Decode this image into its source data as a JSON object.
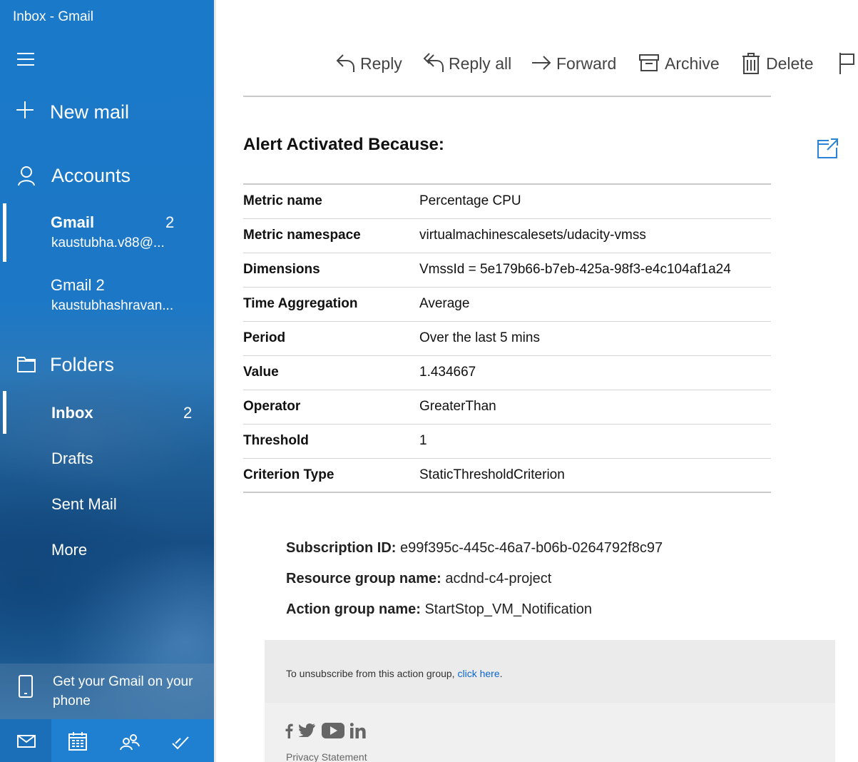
{
  "window": {
    "title": "Inbox - Gmail"
  },
  "sidebar": {
    "new_mail_label": "New mail",
    "accounts_label": "Accounts",
    "accounts": [
      {
        "name": "Gmail",
        "email": "kaustubha.v88@...",
        "unread": "2"
      },
      {
        "name": "Gmail 2",
        "email": "kaustubhashravan..."
      }
    ],
    "folders_label": "Folders",
    "folders": [
      {
        "label": "Inbox",
        "unread": "2"
      },
      {
        "label": "Drafts"
      },
      {
        "label": "Sent Mail"
      },
      {
        "label": "More"
      }
    ],
    "phone_promo": "Get your Gmail on your phone",
    "bottom_nav": [
      "mail-icon",
      "calendar-icon",
      "people-icon",
      "todo-icon"
    ]
  },
  "toolbar": {
    "reply": "Reply",
    "reply_all": "Reply all",
    "forward": "Forward",
    "archive": "Archive",
    "delete": "Delete"
  },
  "email": {
    "heading": "Alert Activated Because:",
    "metrics": [
      {
        "key": "Metric name",
        "value": "Percentage CPU"
      },
      {
        "key": "Metric namespace",
        "value": "virtualmachinescalesets/udacity-vmss"
      },
      {
        "key": "Dimensions",
        "value": "VmssId = 5e179b66-b7eb-425a-98f3-e4c104af1a24"
      },
      {
        "key": "Time Aggregation",
        "value": "Average"
      },
      {
        "key": "Period",
        "value": "Over the last 5 mins"
      },
      {
        "key": "Value",
        "value": "1.434667"
      },
      {
        "key": "Operator",
        "value": "GreaterThan"
      },
      {
        "key": "Threshold",
        "value": "1"
      },
      {
        "key": "Criterion Type",
        "value": "StaticThresholdCriterion"
      }
    ],
    "subscription_label": "Subscription ID:",
    "subscription_value": "e99f395c-445c-46a7-b06b-0264792f8c97",
    "resource_group_label": "Resource group name:",
    "resource_group_value": "acdnd-c4-project",
    "action_group_label": "Action group name:",
    "action_group_value": "StartStop_VM_Notification",
    "unsubscribe_text": "To unsubscribe from this action group, ",
    "unsubscribe_link": "click here",
    "unsubscribe_end": ".",
    "privacy": "Privacy Statement"
  },
  "colors": {
    "sidebar_accent": "#1a79c9",
    "link": "#0b66d6"
  }
}
